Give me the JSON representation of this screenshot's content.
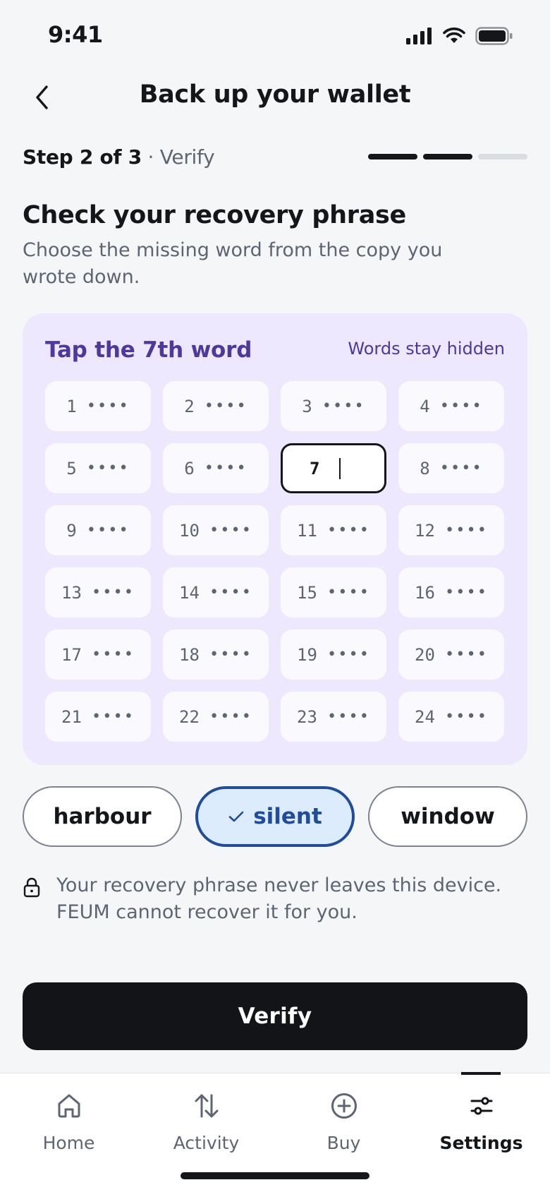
{
  "status_bar": {
    "time": "9:41"
  },
  "header": {
    "title": "Back up your wallet"
  },
  "step": {
    "label": "Step 2 of 3",
    "separator": " · ",
    "name": "Verify",
    "progress": {
      "completed": 2,
      "total": 3
    }
  },
  "content": {
    "title": "Check your recovery phrase",
    "subtitle": "Choose the missing word from the copy you wrote down."
  },
  "phrase_card": {
    "title": "Tap the 7th word",
    "hint": "Words stay hidden",
    "mask": "••••",
    "active_index": "7",
    "cells": [
      "1",
      "2",
      "3",
      "4",
      "5",
      "6",
      "7",
      "8",
      "9",
      "10",
      "11",
      "12",
      "13",
      "14",
      "15",
      "16",
      "17",
      "18",
      "19",
      "20",
      "21",
      "22",
      "23",
      "24"
    ]
  },
  "choices": [
    {
      "label": "harbour",
      "selected": false
    },
    {
      "label": "silent",
      "selected": true
    },
    {
      "label": "window",
      "selected": false
    }
  ],
  "note": {
    "text": "Your recovery phrase never leaves this device. FEUM cannot recover it for you."
  },
  "verify_button": {
    "label": "Verify"
  },
  "tabbar": {
    "items": [
      {
        "label": "Home",
        "icon": "home-icon"
      },
      {
        "label": "Activity",
        "icon": "arrows-up-down-icon"
      },
      {
        "label": "Buy",
        "icon": "plus-circle-icon"
      },
      {
        "label": "Settings",
        "icon": "sliders-icon",
        "active": true
      }
    ]
  },
  "colors": {
    "accent_purple": "#4a3a9e",
    "selected_blue": "#1f4d9c",
    "selected_bg": "#dcecfd",
    "card_bg": "#ede8fd"
  }
}
